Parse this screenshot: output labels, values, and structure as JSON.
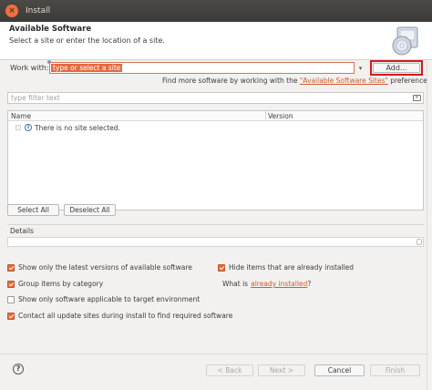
{
  "window": {
    "title": "Install",
    "close_glyph": "×"
  },
  "banner": {
    "title": "Available Software",
    "subtitle": "Select a site or enter the location of a site.",
    "icon": "install-wizard-cd-icon"
  },
  "work_with": {
    "label": "Work with:",
    "placeholder": "type or select a site",
    "dropdown_glyph": "▾",
    "add_button": "Add...",
    "find_more_prefix": "Find more software by working with the ",
    "find_more_link": "\"Available Software Sites\"",
    "find_more_suffix": " preferences."
  },
  "filter": {
    "placeholder": "type filter text",
    "clear_icon": "clear-filter-icon"
  },
  "tree": {
    "columns": [
      "Name",
      "Version"
    ],
    "rows": [
      {
        "text": "There is no site selected.",
        "icon": "info-icon"
      }
    ]
  },
  "selection_buttons": {
    "select_all": "Select All",
    "deselect_all": "Deselect All"
  },
  "details": {
    "label": "Details"
  },
  "options": {
    "latest_versions": {
      "label": "Show only the latest versions of available software",
      "checked": true
    },
    "group_by_category": {
      "label": "Group items by category",
      "checked": true
    },
    "applicable_only": {
      "label": "Show only software applicable to target environment",
      "checked": false
    },
    "contact_all_sites": {
      "label": "Contact all update sites during install to find required software",
      "checked": true
    },
    "hide_installed": {
      "label": "Hide items that are already installed",
      "checked": true
    },
    "what_is_prefix": "What is",
    "what_is_link": "already installed",
    "what_is_suffix": "?"
  },
  "footer": {
    "help_glyph": "?",
    "back": "< Back",
    "next": "Next >",
    "cancel": "Cancel",
    "finish": "Finish"
  },
  "colors": {
    "accent": "#e26a3c",
    "link": "#d15b2d",
    "highlight_border": "#d11c1c"
  }
}
